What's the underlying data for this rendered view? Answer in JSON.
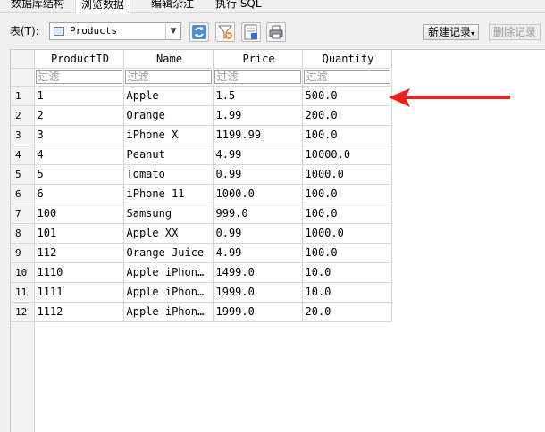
{
  "tabs": [
    "数据库结构",
    "浏览数据",
    "编辑杂注",
    "执行 SQL"
  ],
  "toolbar": {
    "table_label": "表(T):",
    "table_value": "Products",
    "new_record": "新建记录",
    "delete_record": "删除记录"
  },
  "grid": {
    "columns": [
      "ProductID",
      "Name",
      "Price",
      "Quantity"
    ],
    "filter_placeholder": "过滤",
    "rows": [
      {
        "n": "1",
        "id": "1",
        "name": "Apple",
        "price": "1.5",
        "qty": "500.0"
      },
      {
        "n": "2",
        "id": "2",
        "name": "Orange",
        "price": "1.99",
        "qty": "200.0"
      },
      {
        "n": "3",
        "id": "3",
        "name": "iPhone X",
        "price": "1199.99",
        "qty": "100.0"
      },
      {
        "n": "4",
        "id": "4",
        "name": "Peanut",
        "price": "4.99",
        "qty": "10000.0"
      },
      {
        "n": "5",
        "id": "5",
        "name": "Tomato",
        "price": "0.99",
        "qty": "1000.0"
      },
      {
        "n": "6",
        "id": "6",
        "name": "iPhone 11",
        "price": "1000.0",
        "qty": "100.0"
      },
      {
        "n": "7",
        "id": "100",
        "name": "Samsung",
        "price": "999.0",
        "qty": "100.0"
      },
      {
        "n": "8",
        "id": "101",
        "name": "Apple XX",
        "price": "0.99",
        "qty": "1000.0"
      },
      {
        "n": "9",
        "id": "112",
        "name": "Orange Juice",
        "price": "4.99",
        "qty": "100.0"
      },
      {
        "n": "10",
        "id": "1110",
        "name": "Apple iPhon…",
        "price": "1499.0",
        "qty": "10.0"
      },
      {
        "n": "11",
        "id": "1111",
        "name": "Apple iPhon…",
        "price": "1999.0",
        "qty": "10.0"
      },
      {
        "n": "12",
        "id": "1112",
        "name": "Apple iPhon…",
        "price": "1999.0",
        "qty": "20.0"
      }
    ]
  },
  "colors": {
    "annotation_arrow": "#e8231f"
  }
}
